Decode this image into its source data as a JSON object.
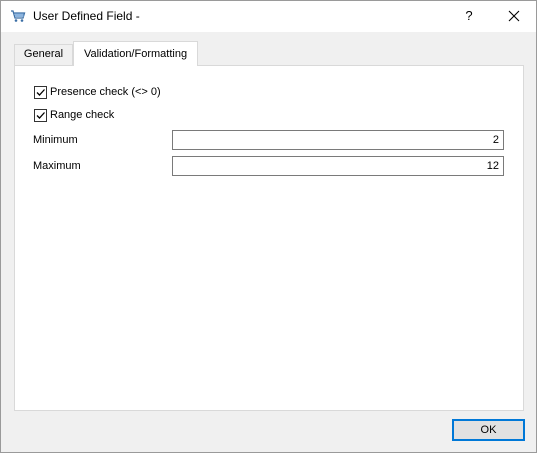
{
  "window": {
    "title": "User Defined Field -",
    "help_label": "?",
    "icons": {
      "app": "cart-icon",
      "close": "close-icon"
    }
  },
  "tabs": [
    {
      "label": "General",
      "active": false
    },
    {
      "label": "Validation/Formatting",
      "active": true
    }
  ],
  "validation": {
    "presence_check": {
      "label": "Presence check (<> 0)",
      "checked": true
    },
    "range_check": {
      "label": "Range check",
      "checked": true
    },
    "minimum": {
      "label": "Minimum",
      "value": "2"
    },
    "maximum": {
      "label": "Maximum",
      "value": "12"
    }
  },
  "footer": {
    "ok_label": "OK"
  },
  "colors": {
    "accent": "#0078d7",
    "panel_bg": "#ffffff",
    "window_bg": "#f0f0f0"
  }
}
